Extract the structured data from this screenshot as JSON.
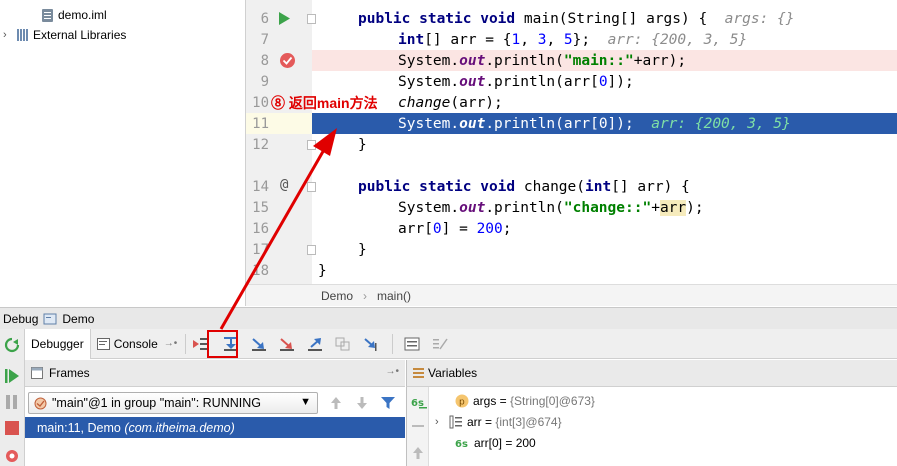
{
  "project_tree": [
    {
      "label": "demo.iml",
      "icon": "file-icon"
    },
    {
      "label": "External Libraries",
      "icon": "library-icon"
    }
  ],
  "editor": {
    "lines": [
      {
        "num": "6"
      },
      {
        "num": "7"
      },
      {
        "num": "8"
      },
      {
        "num": "9"
      },
      {
        "num": "10"
      },
      {
        "num": "11"
      },
      {
        "num": "12"
      },
      {
        "num": "14"
      },
      {
        "num": "15"
      },
      {
        "num": "16"
      },
      {
        "num": "17"
      },
      {
        "num": "18"
      }
    ],
    "code": {
      "l6_kw": "public static void ",
      "l6_rest": "main(String[] args) {  ",
      "l6_hint": "args: {}",
      "l7_kw": "int",
      "l7_a": "[] arr = {",
      "l7_n1": "1",
      "l7_b": ", ",
      "l7_n2": "3",
      "l7_c": ", ",
      "l7_n3": "5",
      "l7_d": "};  ",
      "l7_hint": "arr: {200, 3, 5}",
      "sys": "System.",
      "out": "out",
      "println": ".println(",
      "l8_str": "\"main::\"",
      "l8_end": "+arr);",
      "l9_end": "arr[",
      "l9_n": "0",
      "l9_close": "]);",
      "l10_method": "change",
      "l10_rest": "(arr);",
      "l11_hint": "arr: {200, 3, 5}",
      "l12": "}",
      "l14_kw": "public static void ",
      "l14_a": "change(",
      "l14_kw2": "int",
      "l14_b": "[] arr) {",
      "l15_str": "\"change::\"",
      "l15_plus": "+",
      "l15_arr": "arr",
      "l15_close": ");",
      "l16_a": "arr[",
      "l16_n": "0",
      "l16_b": "] = ",
      "l16_n2": "200",
      "l16_c": ";",
      "l17": "}",
      "l18": "}"
    }
  },
  "breadcrumb": {
    "class_name": "Demo",
    "separator": "›",
    "method": "main()"
  },
  "annotation": {
    "text": "⑧ 返回main方法",
    "color": "#e00000"
  },
  "debug": {
    "title": "Debug",
    "config": "Demo",
    "tabs": {
      "debugger": "Debugger",
      "console": "Console"
    },
    "frames_title": "Frames",
    "variables_title": "Variables",
    "thread": "\"main\"@1 in group \"main\": RUNNING",
    "frame": {
      "location": "main:11, Demo ",
      "package": "(com.itheima.demo)"
    },
    "variables": [
      {
        "name": "args",
        "value": "{String[0]@673}",
        "badge": "p"
      },
      {
        "name": "arr",
        "value": "{int[3]@674}"
      },
      {
        "name": "arr[0]",
        "value": "200"
      }
    ],
    "equals": " = "
  },
  "colors": {
    "selection": "#2a5bab",
    "keyword": "#000080",
    "string": "#008000",
    "breakpoint_line": "#fbe5e3",
    "annotation": "#e00000"
  }
}
